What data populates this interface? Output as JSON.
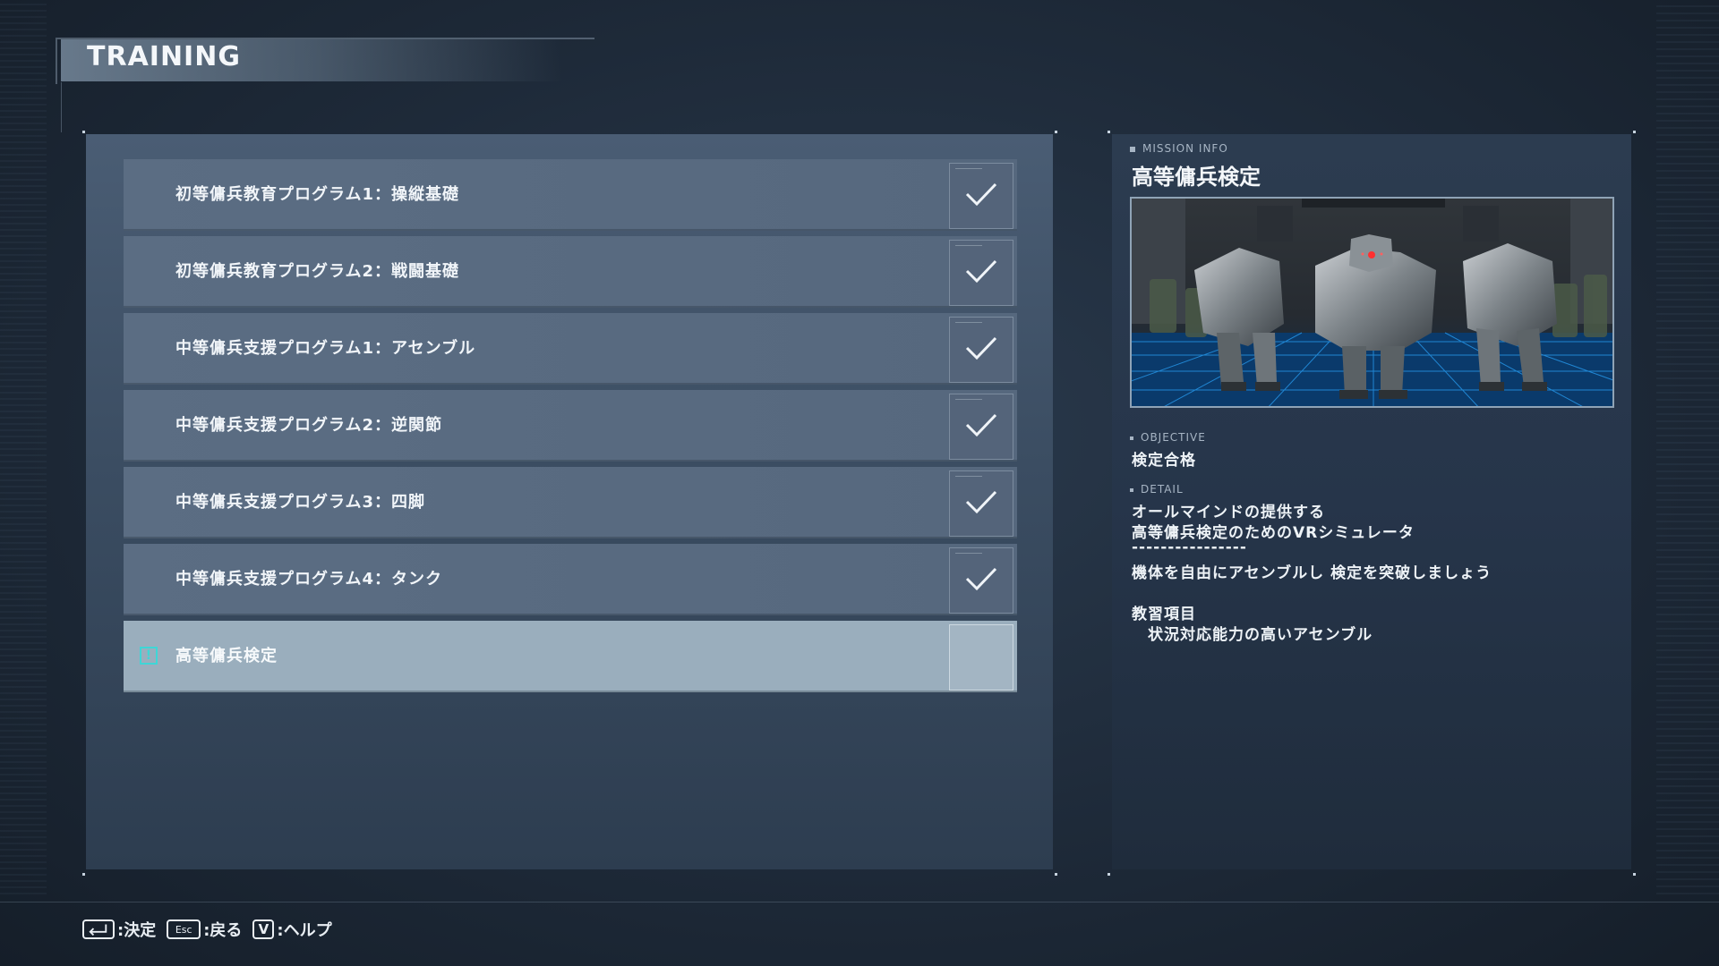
{
  "header": {
    "title": "TRAINING"
  },
  "missions": [
    {
      "label": "初等傭兵教育プログラム1：操縦基礎",
      "completed": true
    },
    {
      "label": "初等傭兵教育プログラム2：戦闘基礎",
      "completed": true
    },
    {
      "label": "中等傭兵支援プログラム1：アセンブル",
      "completed": true
    },
    {
      "label": "中等傭兵支援プログラム2：逆関節",
      "completed": true
    },
    {
      "label": "中等傭兵支援プログラム3：四脚",
      "completed": true
    },
    {
      "label": "中等傭兵支援プログラム4：タンク",
      "completed": true
    },
    {
      "label": "高等傭兵検定",
      "completed": false,
      "selected": true,
      "icon": "alert-icon"
    }
  ],
  "info": {
    "section_label": "MISSION INFO",
    "title": "高等傭兵検定",
    "objective_label": "OBJECTIVE",
    "objective": "検定合格",
    "detail_label": "DETAIL",
    "detail_lines": [
      "オールマインドの提供する",
      "高等傭兵検定のためのVRシミュレータ",
      "----------------",
      "機体を自由にアセンブルし 検定を突破しましょう",
      "",
      "教習項目",
      "　状況対応能力の高いアセンブル"
    ]
  },
  "footer": {
    "confirm_key_icon": "enter-key-icon",
    "confirm_label": ":決定",
    "back_key": "Esc",
    "back_label": ":戻る",
    "help_key": "V",
    "help_label": ":ヘルプ"
  },
  "colors": {
    "accent_cyan": "#3fd6d6",
    "selected_row": "#9aaebd",
    "row": "#5b6d83",
    "panel": "#3b4d62"
  }
}
